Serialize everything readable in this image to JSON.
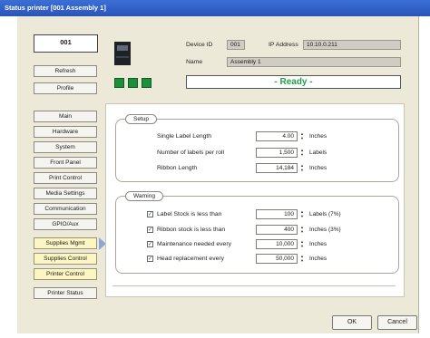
{
  "window": {
    "title": "Status printer [001 Assembly 1]"
  },
  "header": {
    "printer_id": "001",
    "device_id_label": "Device ID",
    "device_id_value": "001",
    "ip_label": "IP Address",
    "ip_value": "10.10.0.211",
    "name_label": "Name",
    "name_value": "Assembly 1",
    "status": "- Ready -"
  },
  "sidebar": {
    "refresh": "Refresh",
    "profile": "Profile",
    "items": [
      "Main",
      "Hardware",
      "System",
      "Front Panel",
      "Print Control",
      "Media Settings",
      "Communication",
      "GPIO/Aux",
      "Supplies Mgmt",
      "Supplies Control",
      "Printer Control",
      "Printer Status"
    ]
  },
  "setup": {
    "legend": "Setup",
    "rows": [
      {
        "label": "Single Label Length",
        "value": "4.00",
        "unit": "Inches"
      },
      {
        "label": "Number of labels per roll",
        "value": "1,500",
        "unit": "Labels"
      },
      {
        "label": "Ribbon Length",
        "value": "14,184",
        "unit": "Inches"
      }
    ]
  },
  "warning": {
    "legend": "Warning",
    "rows": [
      {
        "label": "Label Stock is less than",
        "value": "100",
        "unit": "Labels (7%)",
        "checked": true
      },
      {
        "label": "Ribbon stock is less than",
        "value": "400",
        "unit": "Inches (3%)",
        "checked": true
      },
      {
        "label": "Maintenance needed every",
        "value": "10,000",
        "unit": "Inches",
        "checked": true
      },
      {
        "label": "Head replacement every",
        "value": "50,000",
        "unit": "Inches",
        "checked": true
      }
    ]
  },
  "buttons": {
    "ok": "OK",
    "cancel": "Cancel"
  },
  "colors": {
    "title_bar": "#2a55b8",
    "status_text": "#22a046",
    "led": "#1d8f3a",
    "highlight": "#fbf6c4"
  }
}
